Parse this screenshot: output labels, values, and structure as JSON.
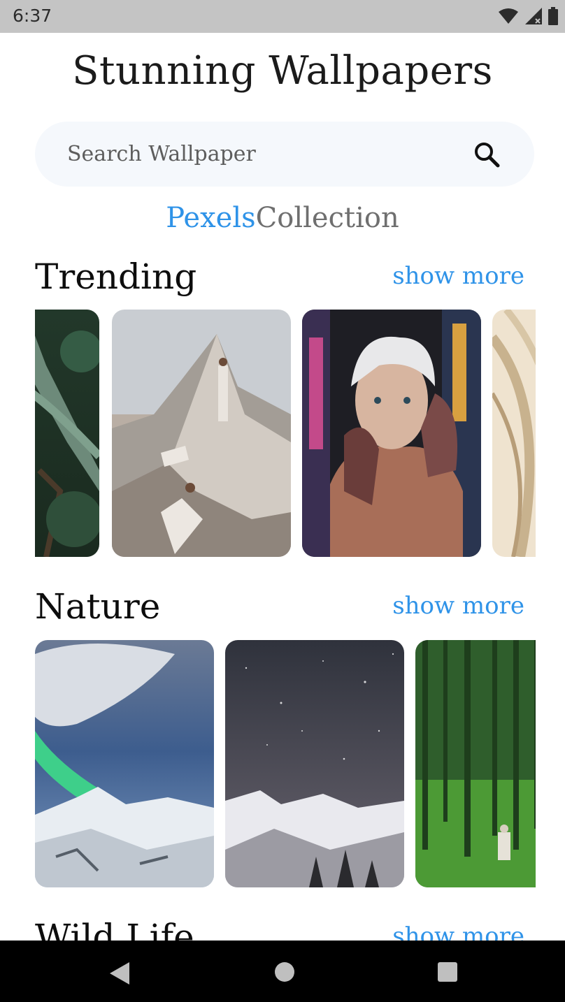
{
  "status_bar": {
    "time": "6:37",
    "icons": [
      "wifi-icon",
      "signal-icon",
      "battery-icon"
    ]
  },
  "app": {
    "title": "Stunning Wallpapers"
  },
  "search": {
    "placeholder": "Search Wallpaper",
    "value": ""
  },
  "brand": {
    "part1": "Pexels",
    "part2": "Collection"
  },
  "sections": [
    {
      "title": "Trending",
      "action": "show more",
      "thumbnails": [
        "jungle-vines-photo",
        "rocky-peak-people-photo",
        "tattooed-man-portrait-photo",
        "curved-architecture-photo"
      ]
    },
    {
      "title": "Nature",
      "action": "show more",
      "thumbnails": [
        "aurora-snowy-mountains-photo",
        "starry-sky-mountain-photo",
        "green-forest-hiker-photo"
      ]
    },
    {
      "title": "Wild Life",
      "action": "show more"
    }
  ],
  "nav_bar": {
    "buttons": [
      "back-icon",
      "home-icon",
      "recents-icon"
    ]
  },
  "colors": {
    "accent": "#2f93e8",
    "search_bg": "#f5f8fc",
    "status_bar": "#c4c4c4",
    "nav_bar": "#000000"
  }
}
